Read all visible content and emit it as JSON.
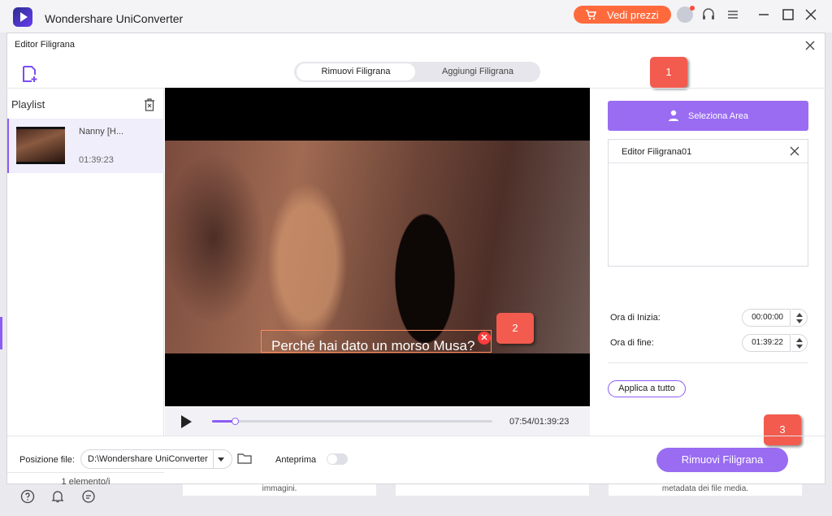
{
  "app": {
    "title": "Wondershare UniConverter"
  },
  "topbar": {
    "price_label": "Vedi prezzi"
  },
  "modal": {
    "title": "Editor Filigrana",
    "tabs": [
      {
        "label": "Rimuovi Filigrana",
        "active": true
      },
      {
        "label": "Aggiungi Filigrana",
        "active": false
      }
    ]
  },
  "badges": [
    "1",
    "2",
    "3"
  ],
  "playlist": {
    "header": "Playlist",
    "items": [
      {
        "name": "Nanny [H...",
        "duration": "01:39:23"
      }
    ],
    "count": "1 elemento/i"
  },
  "video": {
    "subtitle": "Perché hai dato un morso Musa?",
    "time": "07:54/01:39:23",
    "progress": 0.08
  },
  "editor": {
    "select_area_label": "Seleziona Area",
    "watermark_item": "Editor Filigrana01",
    "start_label": "Ora di Inizia:",
    "start_value": "00:00:00",
    "end_label": "Ora di fine:",
    "end_value": "01:39:22",
    "apply_all_label": "Applica a tutto"
  },
  "footer": {
    "file_position_label": "Posizione file:",
    "file_position_value": "D:\\Wondershare UniConverter",
    "preview_label": "Anteprima",
    "preview_on": false,
    "remove_button_label": "Rimuovi Filigrana"
  },
  "background": {
    "left_text": "immagini.",
    "right_text": "metadata dei file media."
  },
  "colors": {
    "accent": "#9a6cf2",
    "price": "#ff6a3d",
    "badge": "#f25b4e"
  }
}
